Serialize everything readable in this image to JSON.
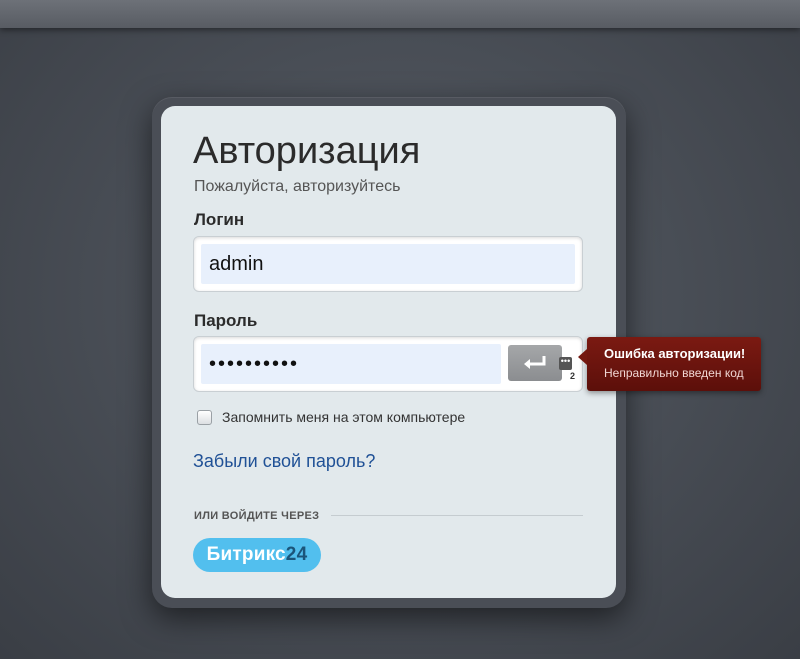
{
  "auth": {
    "title": "Авторизация",
    "subtitle": "Пожалуйста, авторизуйтесь",
    "login_label": "Логин",
    "login_value": "admin",
    "password_label": "Пароль",
    "password_value": "••••••••••",
    "keyboard_indicator": "2",
    "remember_label": "Запомнить меня на этом компьютере",
    "remember_checked": false,
    "forgot_link": "Забыли свой пароль?",
    "or_login_via": "ИЛИ ВОЙДИТЕ ЧЕРЕЗ",
    "bitrix_text": "Битрикс",
    "bitrix_num": "24"
  },
  "error": {
    "title": "Ошибка авторизации!",
    "message": "Неправильно введен код"
  },
  "icons": {
    "enter": "enter-arrow-icon",
    "keyboard": "keyboard-icon"
  },
  "colors": {
    "card_bg": "#e2e9ec",
    "link": "#205196",
    "bitrix_blue": "#52bfee",
    "error_bg": "#6b140e"
  }
}
